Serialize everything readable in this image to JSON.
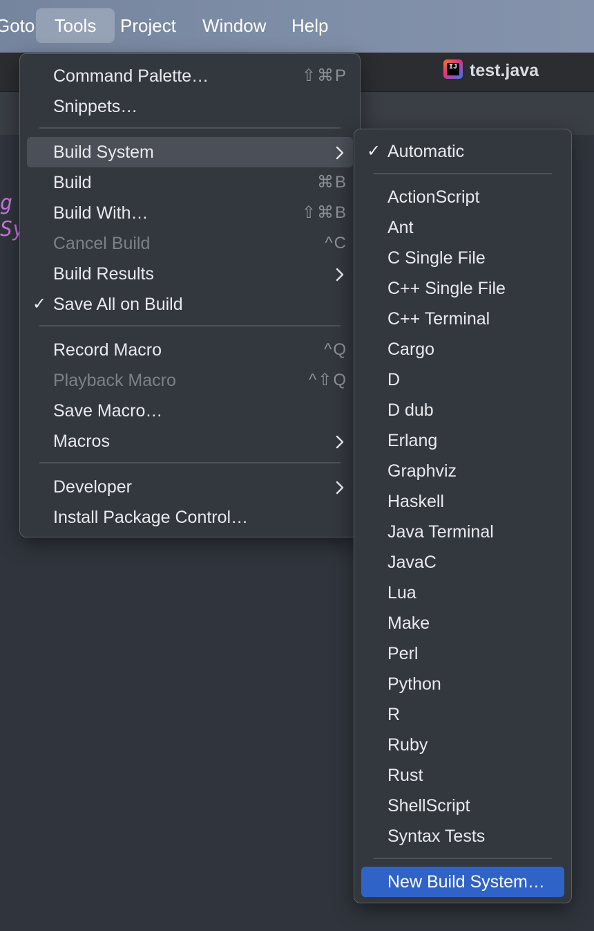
{
  "menubar": {
    "items": [
      "Goto",
      "Tools",
      "Project",
      "Window",
      "Help"
    ],
    "active": "Tools"
  },
  "tab": {
    "title": "test.java",
    "icon": "intellij-idea-icon"
  },
  "editor": {
    "line1_a": "g",
    "line1_b": "[",
    "line2": "Sy"
  },
  "tools_menu": {
    "items": [
      {
        "label": "Command Palette…",
        "shortcut": "⇧⌘P"
      },
      {
        "label": "Snippets…"
      },
      {
        "label": "Build System",
        "submenu": true
      },
      {
        "label": "Build",
        "shortcut": "⌘B"
      },
      {
        "label": "Build With…",
        "shortcut": "⇧⌘B"
      },
      {
        "label": "Cancel Build",
        "shortcut": "^C",
        "disabled": true
      },
      {
        "label": "Build Results",
        "submenu": true
      },
      {
        "label": "Save All on Build",
        "checked": true
      },
      {
        "label": "Record Macro",
        "shortcut": "^Q"
      },
      {
        "label": "Playback Macro",
        "shortcut": "^⇧Q",
        "disabled": true
      },
      {
        "label": "Save Macro…"
      },
      {
        "label": "Macros",
        "submenu": true
      },
      {
        "label": "Developer",
        "submenu": true
      },
      {
        "label": "Install Package Control…"
      }
    ]
  },
  "build_system_menu": {
    "automatic": "Automatic",
    "items": [
      "ActionScript",
      "Ant",
      "C Single File",
      "C++ Single File",
      "C++ Terminal",
      "Cargo",
      "D",
      "D dub",
      "Erlang",
      "Graphviz",
      "Haskell",
      "Java Terminal",
      "JavaC",
      "Lua",
      "Make",
      "Perl",
      "Python",
      "R",
      "Ruby",
      "Rust",
      "ShellScript",
      "Syntax Tests"
    ],
    "new": "New Build System…"
  },
  "colors": {
    "selection": "#2f63c7",
    "menu_bg": "#33373e",
    "editor_bg": "#30353d",
    "syntax_pink": "#c678dd",
    "syntax_red": "#e06c75"
  }
}
